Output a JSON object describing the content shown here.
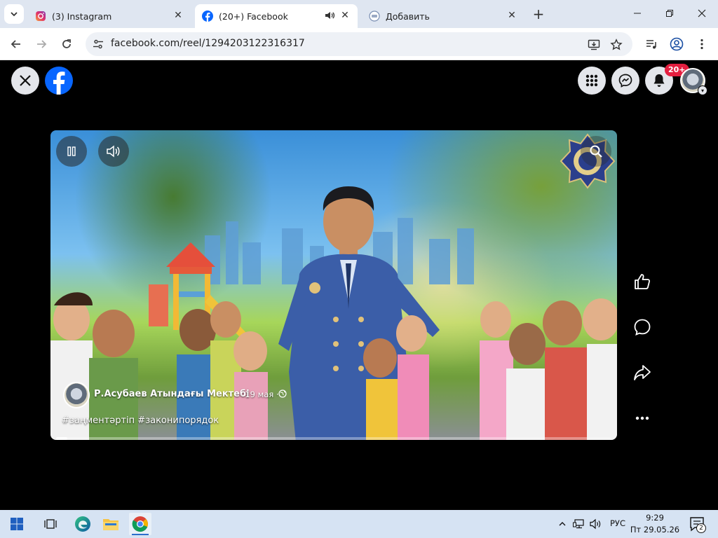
{
  "browser": {
    "tabs": [
      {
        "title": "(3) Instagram",
        "active": false
      },
      {
        "title": "(20+) Facebook",
        "active": true,
        "playing_audio": true
      },
      {
        "title": "Добавить",
        "active": false
      }
    ],
    "url": "facebook.com/reel/1294203122316317",
    "icons": {
      "tab_search": "chevron-down-icon",
      "close_tab": "close-icon",
      "new_tab": "plus-icon",
      "minimize": "minimize-icon",
      "restore": "restore-icon",
      "close_window": "close-icon",
      "back": "arrow-left-icon",
      "forward": "arrow-right-icon",
      "reload": "reload-icon",
      "site_info": "tune-icon",
      "install": "install-app-icon",
      "bookmark": "star-icon",
      "media": "media-control-icon",
      "profile": "profile-icon",
      "menu": "kebab-menu-icon"
    }
  },
  "facebook": {
    "notification_badge": "20+",
    "post": {
      "author": "Р.Асубаев Атындағы Мектебі",
      "date": "· 19 мая ·",
      "hashtags": "#заңментәртіп #законипорядок",
      "progress": 0.02
    },
    "colors": {
      "brand": "#0866ff",
      "badge": "#e41e3f",
      "background": "#000000"
    }
  },
  "taskbar": {
    "lang": "РУС",
    "time": "9:29",
    "date": "Пт 29.05.26",
    "notification_count": "2",
    "apps": [
      "start-icon",
      "task-view-icon",
      "edge-icon",
      "file-explorer-icon",
      "chrome-icon"
    ]
  }
}
